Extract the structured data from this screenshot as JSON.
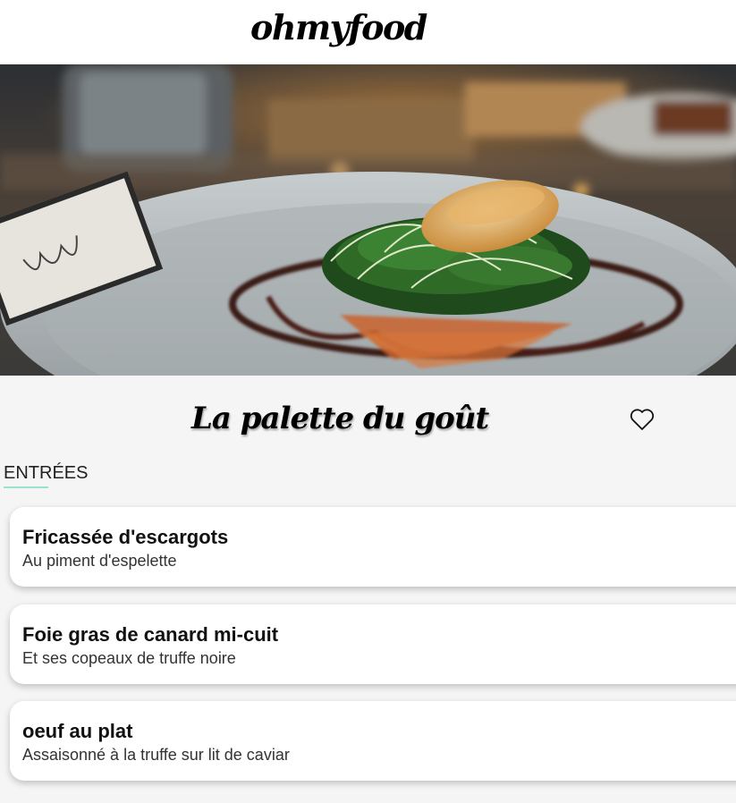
{
  "header": {
    "logo": "ohmyfood"
  },
  "hero": {
    "image_alt": "Plated fish dish with microgreens on a grey plate"
  },
  "restaurant": {
    "name": "La palette du goût",
    "favorite_icon": "heart-outline-icon"
  },
  "menu": {
    "section_title": "ENTRÉES",
    "accent_color": "#99e2d0",
    "items": [
      {
        "name": "Fricassée d'escargots",
        "description": "Au piment d'espelette"
      },
      {
        "name": "Foie gras de canard mi-cuit",
        "description": "Et ses copeaux de truffe noire"
      },
      {
        "name": "oeuf au plat",
        "description": "Assaisonné à la truffe sur lit de caviar"
      }
    ]
  }
}
